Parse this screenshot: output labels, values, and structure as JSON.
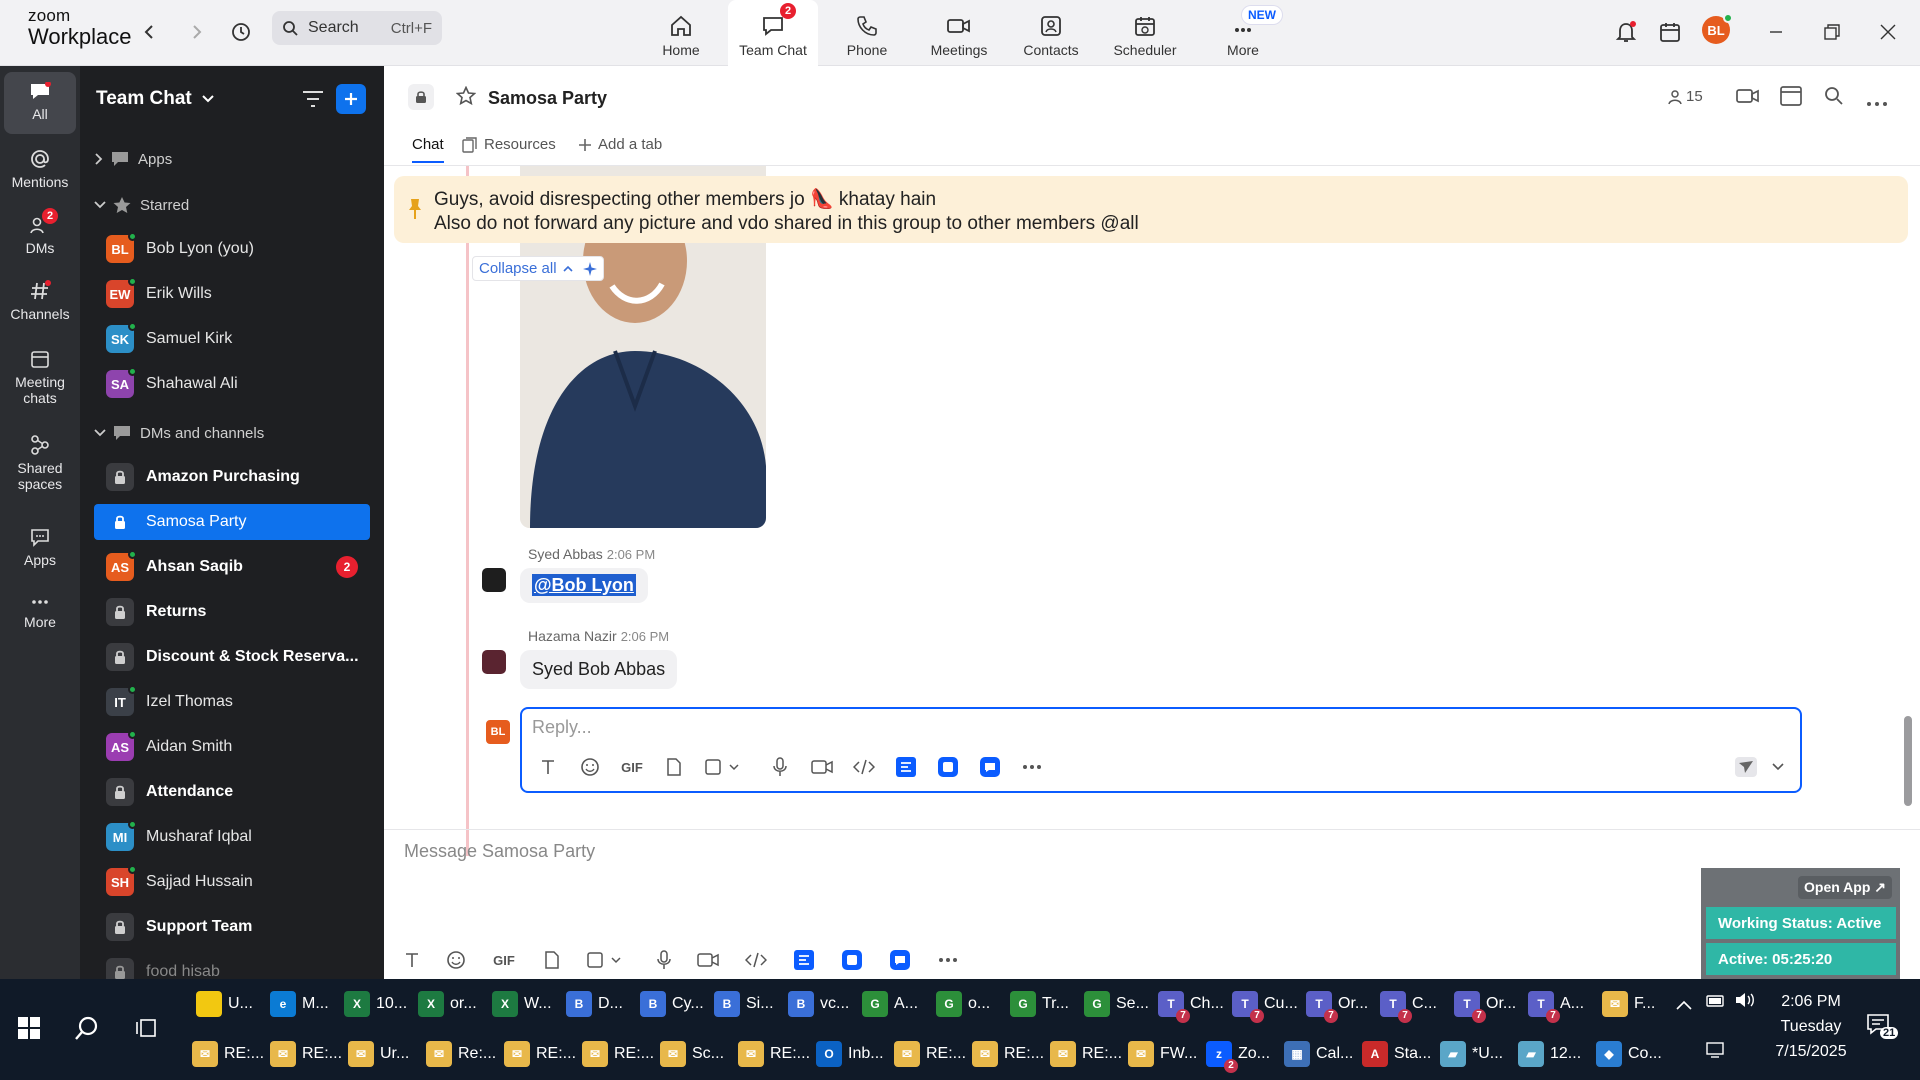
{
  "app": {
    "logo_line1": "zoom",
    "logo_line2": "Workplace"
  },
  "search": {
    "label": "Search",
    "shortcut": "Ctrl+F"
  },
  "nav": [
    {
      "label": "Home",
      "icon": "home-icon"
    },
    {
      "label": "Team Chat",
      "icon": "chat-icon",
      "badge": "2",
      "active": true
    },
    {
      "label": "Phone",
      "icon": "phone-icon"
    },
    {
      "label": "Meetings",
      "icon": "video-icon"
    },
    {
      "label": "Contacts",
      "icon": "contacts-icon"
    },
    {
      "label": "Scheduler",
      "icon": "calendar-icon"
    },
    {
      "label": "More",
      "icon": "more-icon",
      "tag": "NEW"
    }
  ],
  "user": {
    "initials": "BL",
    "color": "#e65c1e"
  },
  "rail": [
    {
      "label": "All",
      "active": true
    },
    {
      "label": "Mentions"
    },
    {
      "label": "DMs",
      "badge": "2"
    },
    {
      "label": "Channels"
    },
    {
      "label": "Meeting chats"
    },
    {
      "label": "Shared spaces"
    },
    {
      "label": "Apps"
    },
    {
      "label": "More"
    }
  ],
  "sidebar": {
    "title": "Team Chat",
    "apps_label": "Apps",
    "starred_label": "Starred",
    "dms_label": "DMs and channels",
    "starred": [
      {
        "name": "Bob Lyon (you)",
        "initials": "BL",
        "color": "#e65c1e"
      },
      {
        "name": "Erik Wills",
        "initials": "EW",
        "color": "#d9452b"
      },
      {
        "name": "Samuel Kirk",
        "initials": "SK",
        "color": "#2c8fc7"
      },
      {
        "name": "Shahawal Ali",
        "initials": "SA",
        "color": "#8e44ad"
      }
    ],
    "items": [
      {
        "name": "Amazon Purchasing",
        "type": "channel",
        "bold": true
      },
      {
        "name": "Samosa Party",
        "type": "channel",
        "selected": true
      },
      {
        "name": "Ahsan Saqib",
        "type": "dm",
        "initials": "AS",
        "color": "#e65c1e",
        "bold": true,
        "count": "2"
      },
      {
        "name": "Returns",
        "type": "channel",
        "bold": true
      },
      {
        "name": "Discount & Stock Reserva...",
        "type": "channel",
        "bold": true
      },
      {
        "name": "Izel Thomas",
        "type": "dm",
        "initials": "IT",
        "color": "#3b4048"
      },
      {
        "name": "Aidan Smith",
        "type": "dm",
        "initials": "AS",
        "color": "#9b3db1"
      },
      {
        "name": "Attendance",
        "type": "channel",
        "bold": true
      },
      {
        "name": "Musharaf Iqbal",
        "type": "dm",
        "initials": "MI",
        "color": "#2c8fc7"
      },
      {
        "name": "Sajjad Hussain",
        "type": "dm",
        "initials": "SH",
        "color": "#d9452b"
      },
      {
        "name": "Support Team",
        "type": "channel",
        "bold": true
      },
      {
        "name": "food hisab",
        "type": "channel"
      }
    ]
  },
  "channel": {
    "title": "Samosa Party",
    "members": "15",
    "tabs": {
      "chat": "Chat",
      "resources": "Resources",
      "add": "Add a tab"
    },
    "pinned_line1": "Guys, avoid disrespecting other members jo 👠 khatay hain",
    "pinned_line2": "Also do not forward any picture and vdo shared in this group to other members @all",
    "collapse_label": "Collapse all",
    "messages": [
      {
        "author": "Syed Abbas",
        "time": "2:06 PM",
        "text": "@Bob Lyon"
      },
      {
        "author": "Hazama Nazir",
        "time": "2:06 PM",
        "text": "Syed Bob Abbas"
      }
    ],
    "reply_placeholder": "Reply...",
    "compose_placeholder": "Message Samosa Party"
  },
  "widget": {
    "open_app": "Open App ↗",
    "status": "Working Status: Active",
    "active": "Active: 05:25:20"
  },
  "taskbar": {
    "row1": [
      {
        "label": "U...",
        "color": "#f2c811",
        "glyph": ""
      },
      {
        "label": "M...",
        "color": "#0b7bd4",
        "glyph": "e"
      },
      {
        "label": "10...",
        "color": "#1d7a41",
        "glyph": "X"
      },
      {
        "label": "or...",
        "color": "#1d7a41",
        "glyph": "X"
      },
      {
        "label": "W...",
        "color": "#1d7a41",
        "glyph": "X"
      },
      {
        "label": "D...",
        "color": "#3a6fd8",
        "glyph": "B"
      },
      {
        "label": "Cy...",
        "color": "#3a6fd8",
        "glyph": "B"
      },
      {
        "label": "Si...",
        "color": "#3a6fd8",
        "glyph": "B"
      },
      {
        "label": "vc...",
        "color": "#3a6fd8",
        "glyph": "B"
      },
      {
        "label": "A...",
        "color": "#2c8f3a",
        "glyph": "G"
      },
      {
        "label": "o...",
        "color": "#2c8f3a",
        "glyph": "G"
      },
      {
        "label": "Tr...",
        "color": "#2c8f3a",
        "glyph": "G"
      },
      {
        "label": "Se...",
        "color": "#2c8f3a",
        "glyph": "G"
      },
      {
        "label": "Ch...",
        "color": "#5b5fc7",
        "glyph": "T",
        "num": "7"
      },
      {
        "label": "Cu...",
        "color": "#5b5fc7",
        "glyph": "T",
        "num": "7"
      },
      {
        "label": "Or...",
        "color": "#5b5fc7",
        "glyph": "T",
        "num": "7"
      },
      {
        "label": "C...",
        "color": "#5b5fc7",
        "glyph": "T",
        "num": "7"
      },
      {
        "label": "Or...",
        "color": "#5b5fc7",
        "glyph": "T",
        "num": "7"
      },
      {
        "label": "A...",
        "color": "#5b5fc7",
        "glyph": "T",
        "num": "7"
      },
      {
        "label": "F...",
        "color": "#e8b84a",
        "glyph": "✉"
      }
    ],
    "row2": [
      {
        "label": "RE:...",
        "color": "#e8b84a",
        "glyph": "✉"
      },
      {
        "label": "RE:...",
        "color": "#e8b84a",
        "glyph": "✉"
      },
      {
        "label": "Ur...",
        "color": "#e8b84a",
        "glyph": "✉"
      },
      {
        "label": "Re:...",
        "color": "#e8b84a",
        "glyph": "✉"
      },
      {
        "label": "RE:...",
        "color": "#e8b84a",
        "glyph": "✉"
      },
      {
        "label": "RE:...",
        "color": "#e8b84a",
        "glyph": "✉"
      },
      {
        "label": "Sc...",
        "color": "#e8b84a",
        "glyph": "✉"
      },
      {
        "label": "RE:...",
        "color": "#e8b84a",
        "glyph": "✉"
      },
      {
        "label": "Inb...",
        "color": "#0b62c4",
        "glyph": "O"
      },
      {
        "label": "RE:...",
        "color": "#e8b84a",
        "glyph": "✉"
      },
      {
        "label": "RE:...",
        "color": "#e8b84a",
        "glyph": "✉"
      },
      {
        "label": "RE:...",
        "color": "#e8b84a",
        "glyph": "✉"
      },
      {
        "label": "FW...",
        "color": "#e8b84a",
        "glyph": "✉"
      },
      {
        "label": "Zo...",
        "color": "#0b5cff",
        "glyph": "z",
        "num": "2"
      },
      {
        "label": "Cal...",
        "color": "#3d6fb6",
        "glyph": "▦"
      },
      {
        "label": "Sta...",
        "color": "#c92a2a",
        "glyph": "A"
      },
      {
        "label": "*U...",
        "color": "#5aa6c8",
        "glyph": "▰"
      },
      {
        "label": "12...",
        "color": "#5aa6c8",
        "glyph": "▰"
      },
      {
        "label": "Co...",
        "color": "#2a7dd1",
        "glyph": "◆"
      }
    ],
    "time": "2:06 PM",
    "day": "Tuesday",
    "date": "7/15/2025",
    "notif_count": "21"
  }
}
